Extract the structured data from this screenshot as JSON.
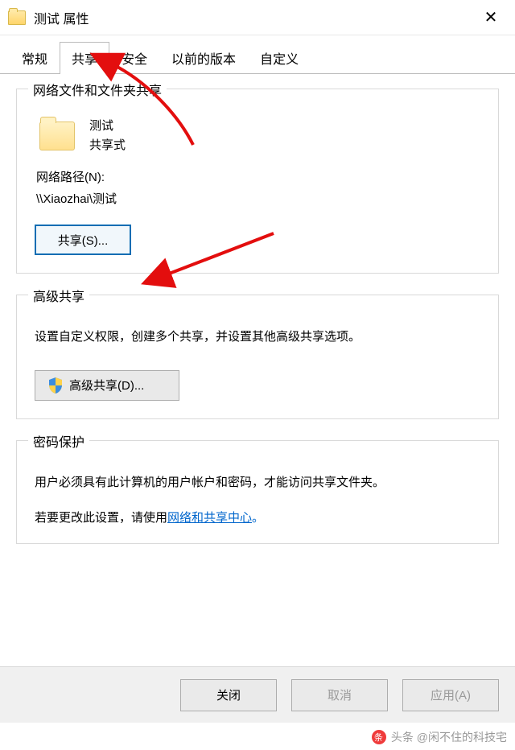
{
  "window": {
    "title": "测试 属性"
  },
  "tabs": {
    "general": "常规",
    "sharing": "共享",
    "security": "安全",
    "previous": "以前的版本",
    "custom": "自定义"
  },
  "network_share": {
    "group_title": "网络文件和文件夹共享",
    "folder_name": "测试",
    "folder_status": "共享式",
    "path_label": "网络路径(N):",
    "path_value": "\\\\Xiaozhai\\测试",
    "share_button": "共享(S)..."
  },
  "advanced_share": {
    "group_title": "高级共享",
    "description": "设置自定义权限，创建多个共享，并设置其他高级共享选项。",
    "button": "高级共享(D)..."
  },
  "password": {
    "group_title": "密码保护",
    "line1": "用户必须具有此计算机的用户帐户和密码，才能访问共享文件夹。",
    "line2_prefix": "若要更改此设置，请使用",
    "link": "网络和共享中心",
    "line2_suffix": "。"
  },
  "buttons": {
    "close": "关闭",
    "cancel": "取消",
    "apply": "应用(A)"
  },
  "watermark": {
    "text": "头条 @闲不住的科技宅"
  }
}
